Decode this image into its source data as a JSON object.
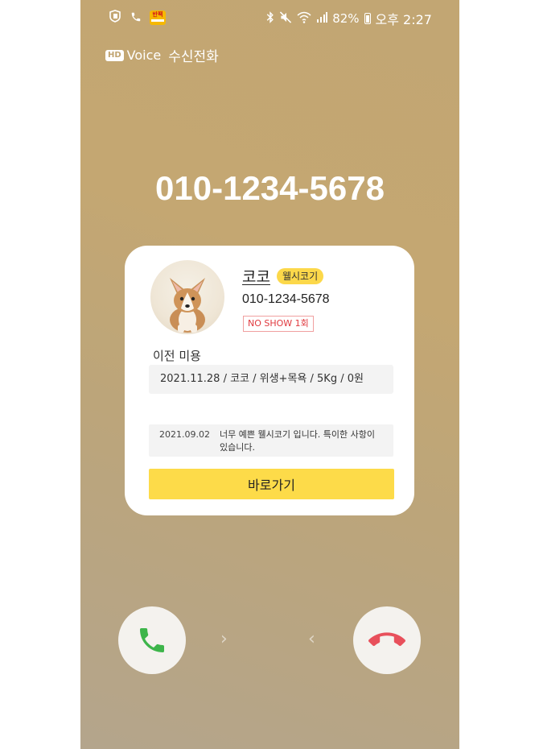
{
  "status_bar": {
    "battery_percent": "82%",
    "time": "오후 2:27",
    "app_badge_text": "반팩"
  },
  "call": {
    "hd_badge": "HD",
    "hd_voice_label": "Voice",
    "call_type": "수신전화",
    "number": "010-1234-5678"
  },
  "card": {
    "pet_name": "코코",
    "breed": "웰시코기",
    "phone": "010-1234-5678",
    "noshow": "NO SHOW 1회",
    "history_title": "이전 미용",
    "history_entry": "2021.11.28 / 코코 / 위생+목욕 / 5Kg / 0원",
    "memo_date": "2021.09.02",
    "memo_text": "너무 예쁜 웰시코기 입니다. 특이한 사항이 있습니다.",
    "go_button": "바로가기"
  },
  "colors": {
    "accent_yellow": "#fddb49",
    "accept_green": "#3db54a",
    "decline_red": "#e8505b",
    "background": "#c2a673"
  },
  "icons": {
    "accept": "phone-icon",
    "decline": "hangup-icon"
  }
}
